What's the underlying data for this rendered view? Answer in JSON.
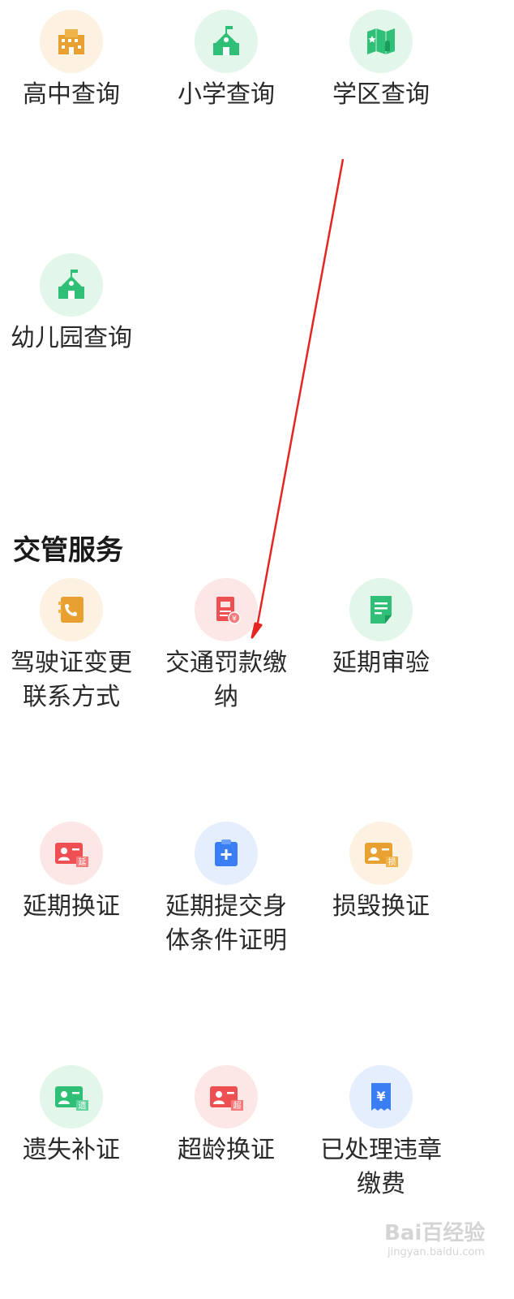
{
  "education": {
    "items": [
      {
        "label": "高中查询",
        "icon": "high-school-building-icon"
      },
      {
        "label": "小学查询",
        "icon": "primary-school-icon"
      },
      {
        "label": "学区查询",
        "icon": "school-district-map-icon"
      },
      {
        "label": "幼儿园查询",
        "icon": "kindergarten-icon"
      }
    ]
  },
  "traffic": {
    "title": "交管服务",
    "items": [
      {
        "label": "驾驶证变更联系方式",
        "icon": "phone-book-icon"
      },
      {
        "label": "交通罚款缴纳",
        "icon": "fine-ticket-icon"
      },
      {
        "label": "延期审验",
        "icon": "document-icon"
      },
      {
        "label": "延期换证",
        "icon": "license-extend-icon",
        "badge": "延"
      },
      {
        "label": "延期提交身体条件证明",
        "icon": "medical-clipboard-icon"
      },
      {
        "label": "损毁换证",
        "icon": "license-damaged-icon",
        "badge": "损"
      },
      {
        "label": "遗失补证",
        "icon": "license-lost-icon",
        "badge": "遗"
      },
      {
        "label": "超龄换证",
        "icon": "license-overage-icon",
        "badge": "超"
      },
      {
        "label": "已处理违章缴费",
        "icon": "receipt-yen-icon",
        "badge": "¥"
      }
    ]
  },
  "colors": {
    "orange": "#e8a030",
    "green": "#2fbf77",
    "red": "#ee4f52",
    "blue": "#3b7df2",
    "annotation_arrow": "#e52521"
  },
  "watermark": {
    "main": "Bai百经验",
    "sub": "jingyan.baidu.com"
  }
}
